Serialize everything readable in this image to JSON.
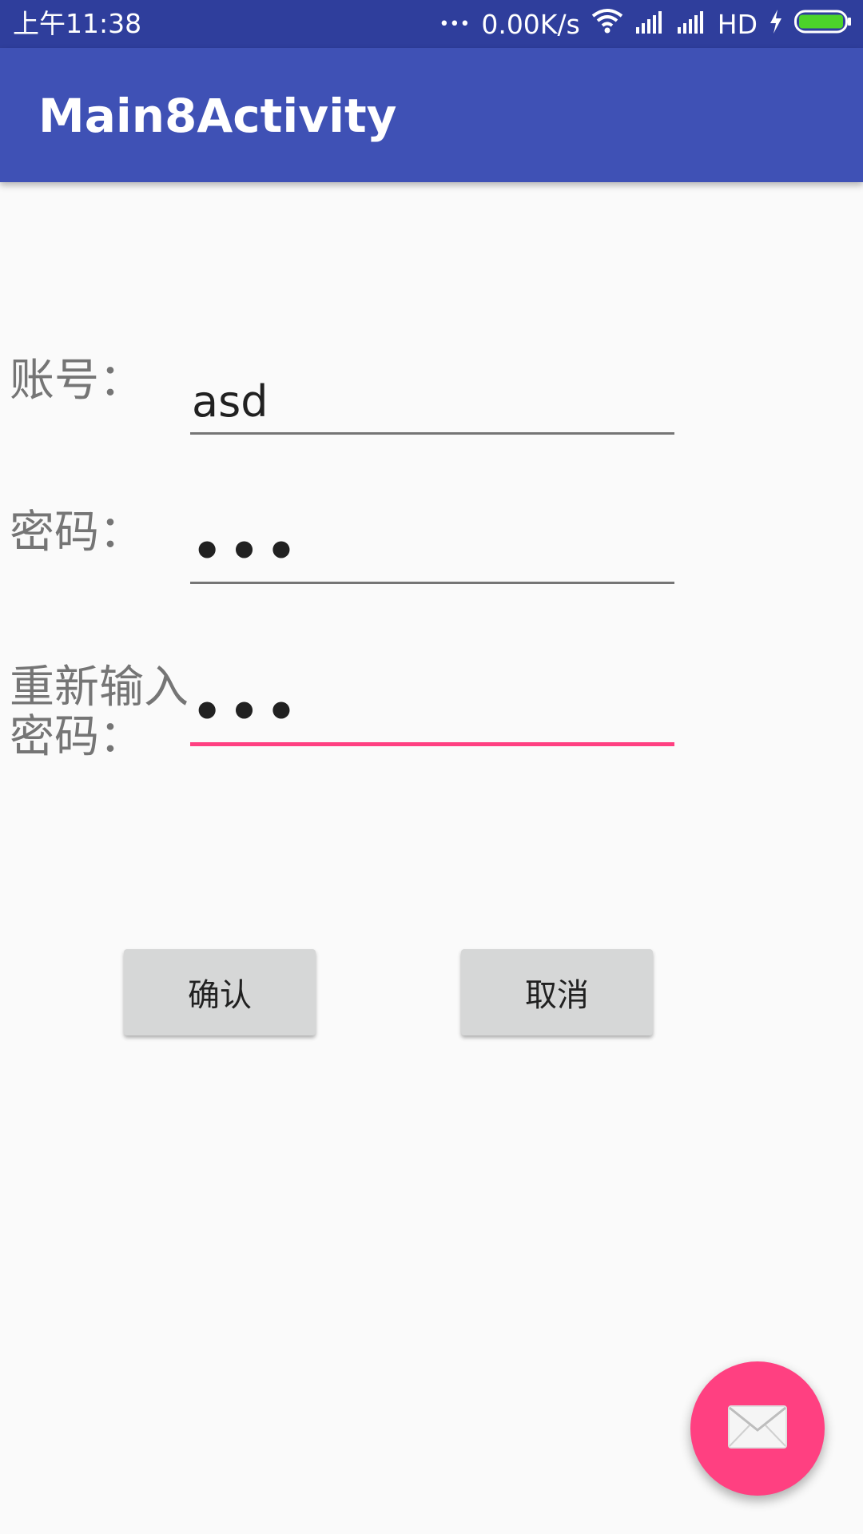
{
  "status_bar": {
    "time": "上午11:38",
    "more": "•••",
    "speed": "0.00K/s",
    "network": "HD",
    "icons": [
      "wifi-icon",
      "signal-icon",
      "signal-icon",
      "charging-icon",
      "battery-icon"
    ]
  },
  "app_bar": {
    "title": "Main8Activity"
  },
  "form": {
    "account_label": "账号：",
    "account_value": "asd",
    "password_label": "密码：",
    "password_value": "•••",
    "confirm_label_line1": "重新输入",
    "confirm_label_line2": "密码：",
    "confirm_value": "•••"
  },
  "buttons": {
    "confirm": "确认",
    "cancel": "取消"
  },
  "fab": {
    "icon": "mail-icon"
  },
  "colors": {
    "primary": "#3f51b5",
    "primary_dark": "#2f3e9c",
    "accent": "#ff4081",
    "battery": "#4cd32a"
  }
}
